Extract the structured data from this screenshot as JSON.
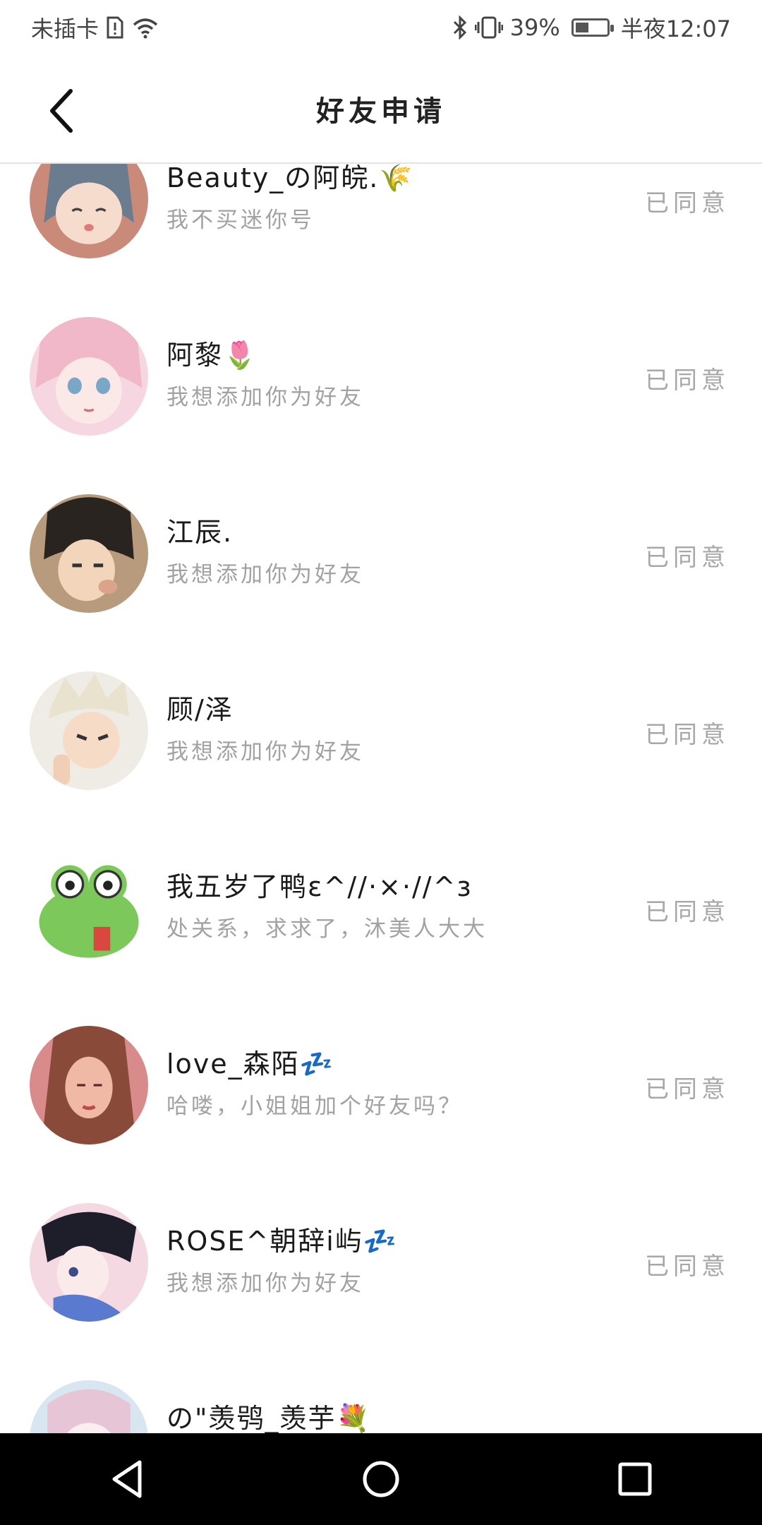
{
  "status_bar": {
    "carrier": "未插卡",
    "battery_percent": "39%",
    "time": "半夜12:07"
  },
  "header": {
    "title": "好友申请"
  },
  "requests": [
    {
      "name": "Beauty_の阿皖.🌾",
      "message": "我不买迷你号",
      "status": "已同意"
    },
    {
      "name": "阿黎🌷",
      "message": "我想添加你为好友",
      "status": "已同意"
    },
    {
      "name": "江辰.",
      "message": "我想添加你为好友",
      "status": "已同意"
    },
    {
      "name": "顾/泽",
      "message": "我想添加你为好友",
      "status": "已同意"
    },
    {
      "name": "我五岁了鸭ε^//·×·//^з",
      "message": "处关系，求求了，沐美人大大",
      "status": "已同意"
    },
    {
      "name": "love_森陌💤",
      "message": "哈喽，小姐姐加个好友吗？",
      "status": "已同意"
    },
    {
      "name": "ROSE^朝辞i屿💤",
      "message": "我想添加你为好友",
      "status": "已同意"
    },
    {
      "name": "の\"羡鸮_羡芋💐",
      "message": "",
      "status": ""
    }
  ],
  "colors": {
    "status_text": "#a7a7a7",
    "message_text": "#a2a2a2",
    "divider": "#e3e3e3",
    "nav_bar": "#000000"
  },
  "icons": [
    "back-arrow-icon",
    "bluetooth-icon",
    "vibrate-icon",
    "battery-icon",
    "wifi-icon",
    "sim-alert-icon",
    "nav-back-icon",
    "nav-home-icon",
    "nav-recents-icon"
  ]
}
